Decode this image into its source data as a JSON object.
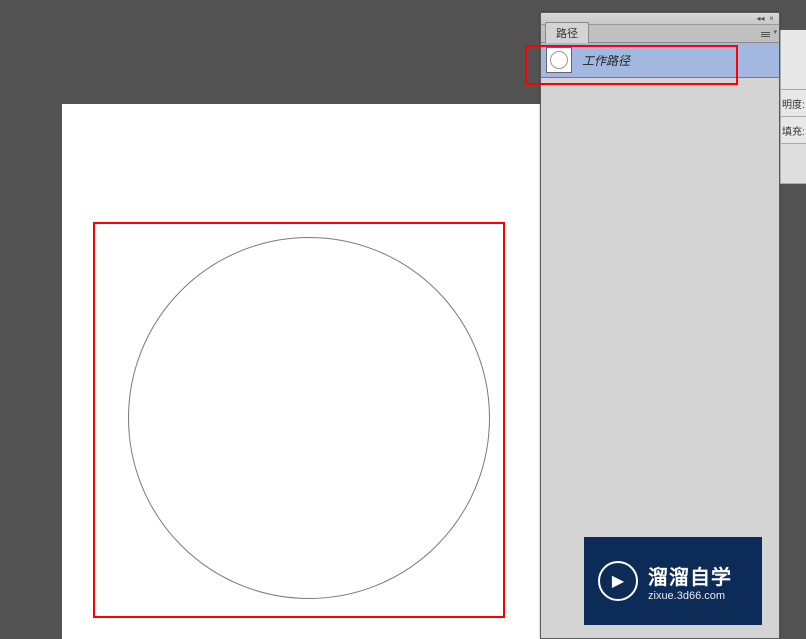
{
  "panel": {
    "tab_label": "路径",
    "path_item_label": "工作路径"
  },
  "side": {
    "item1": "明度:",
    "item2": "填充:"
  },
  "watermark": {
    "title": "溜溜自学",
    "url": "zixue.3d66.com"
  }
}
